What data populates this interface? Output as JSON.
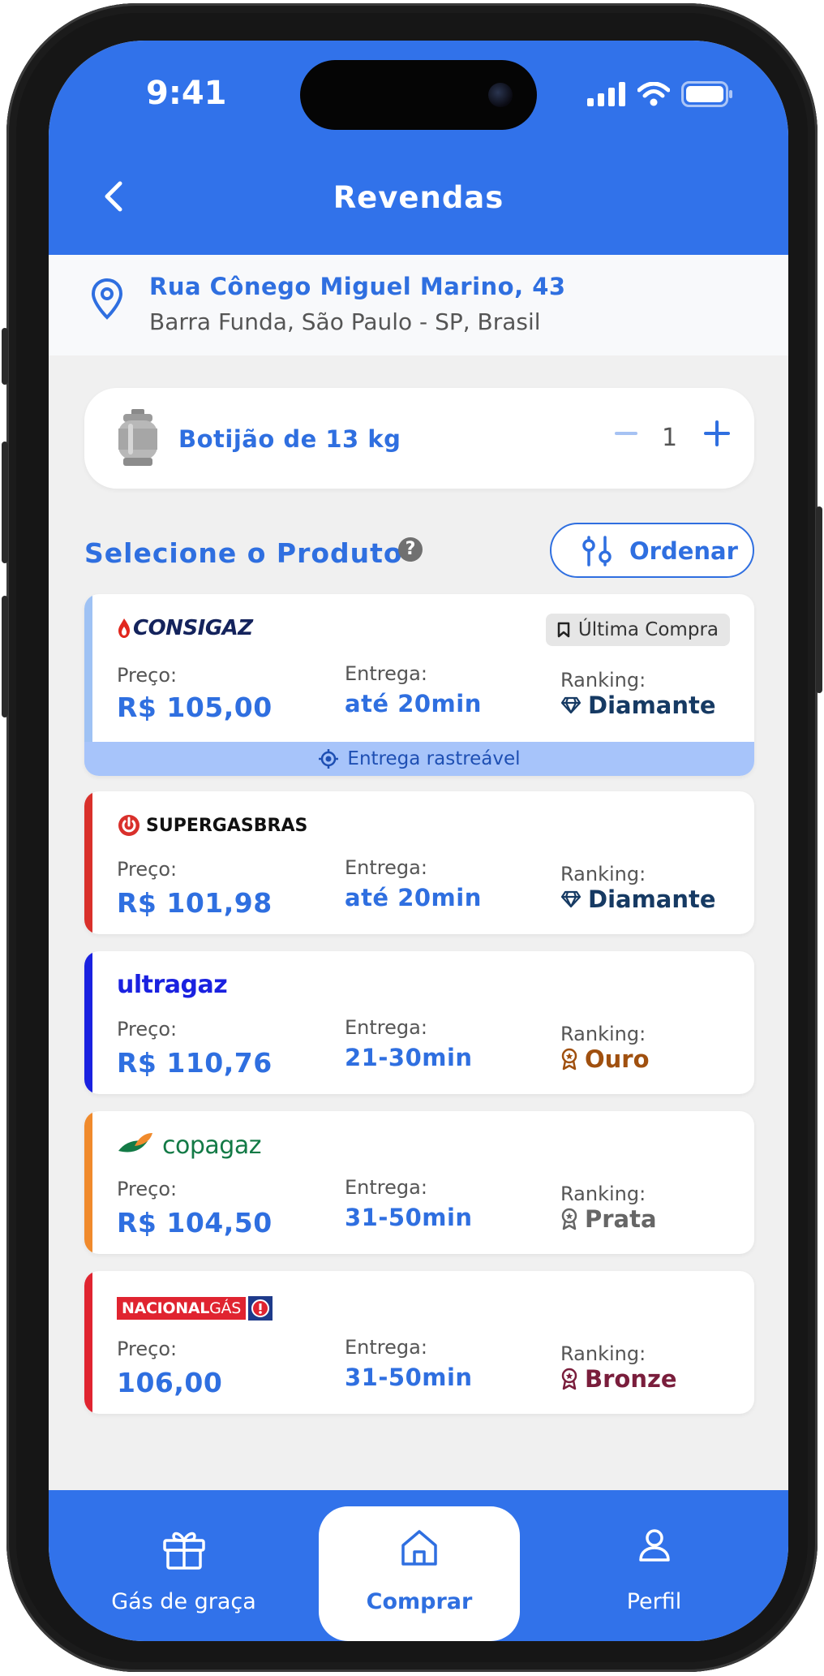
{
  "status": {
    "time": "9:41"
  },
  "header": {
    "title": "Revendas"
  },
  "address": {
    "line1": "Rua Cônego Miguel Marino, 43",
    "line2": "Barra Funda, São Paulo - SP, Brasil"
  },
  "product": {
    "name": "Botijão de 13 kg",
    "quantity": "1",
    "minus": "−",
    "plus": "+"
  },
  "section": {
    "title": "Selecione o Produto",
    "help": "?",
    "order_label": "Ordenar"
  },
  "labels": {
    "price": "Preço:",
    "delivery": "Entrega:",
    "ranking": "Ranking:"
  },
  "sellers": [
    {
      "brand": "CONSIGAZ",
      "price": "R$ 105,00",
      "delivery": "até 20min",
      "ranking": "Diamante",
      "badge": "Última Compra",
      "tracking": "Entrega rastreável",
      "stripe_color": "#9fc2f4",
      "rank_color": "#163a63"
    },
    {
      "brand": "SUPERGASBRAS",
      "price": "R$ 101,98",
      "delivery": "até 20min",
      "ranking": "Diamante",
      "stripe_color": "#d9302b",
      "rank_color": "#163a63"
    },
    {
      "brand": "ultragaz",
      "price": "R$ 110,76",
      "delivery": "21-30min",
      "ranking": "Ouro",
      "stripe_color": "#1a21e0",
      "rank_color": "#a0500f"
    },
    {
      "brand": "copagaz",
      "price": "R$ 104,50",
      "delivery": "31-50min",
      "ranking": "Prata",
      "stripe_color": "#f08a2c",
      "rank_color": "#666666"
    },
    {
      "brand_part1": "NACIONAL",
      "brand_part2": "GÁS",
      "price": "106,00",
      "delivery": "31-50min",
      "ranking": "Bronze",
      "stripe_color": "#e02430",
      "rank_color": "#7a1e3c"
    }
  ],
  "tabs": [
    {
      "label": "Gás de graça",
      "icon": "gift-icon"
    },
    {
      "label": "Comprar",
      "icon": "home-icon",
      "active": true
    },
    {
      "label": "Perfil",
      "icon": "user-icon"
    }
  ],
  "colors": {
    "primary": "#3172ea",
    "accent": "#2f6fe0"
  }
}
